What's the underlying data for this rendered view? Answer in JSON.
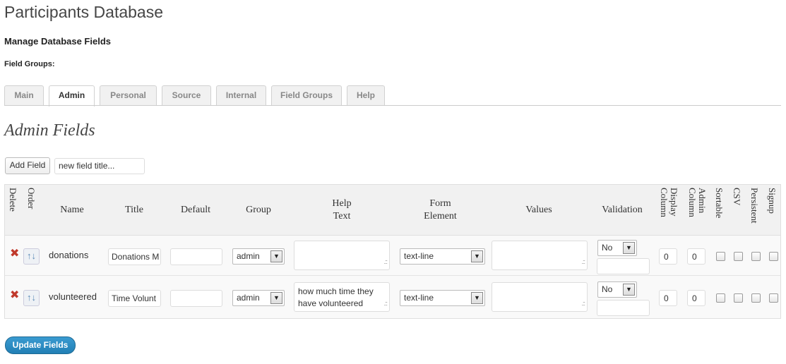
{
  "page": {
    "title": "Participants Database",
    "subtitle": "Manage Database Fields",
    "field_groups_label": "Field Groups:"
  },
  "tabs": [
    {
      "label": "Main"
    },
    {
      "label": "Admin",
      "active": true
    },
    {
      "label": "Personal"
    },
    {
      "label": "Source"
    },
    {
      "label": "Internal"
    },
    {
      "label": "Field Groups"
    },
    {
      "label": "Help"
    }
  ],
  "section": {
    "title": "Admin Fields"
  },
  "add_field": {
    "button_label": "Add Field",
    "input_value": "new field title..."
  },
  "table": {
    "headers": {
      "delete": "Delete",
      "order": "Order",
      "name": "Name",
      "title": "Title",
      "default": "Default",
      "group": "Group",
      "help_text_1": "Help",
      "help_text_2": "Text",
      "form_element_1": "Form",
      "form_element_2": "Element",
      "values": "Values",
      "validation": "Validation",
      "display_column": "Display Column",
      "admin_column": "Admin Column",
      "sortable": "Sortable",
      "csv": "CSV",
      "persistent": "Persistent",
      "signup": "Signup"
    },
    "rows": [
      {
        "name": "donations",
        "title": "Donations M",
        "default": "",
        "group": "admin",
        "help_text": "",
        "form_element": "text-line",
        "values": "",
        "validation": "No",
        "validation_extra": "",
        "display_column": "0",
        "admin_column": "0",
        "sortable": false,
        "csv": false,
        "persistent": false,
        "signup": false
      },
      {
        "name": "volunteered",
        "title": "Time Volunt",
        "default": "",
        "group": "admin",
        "help_text": "how much time they have volunteered",
        "form_element": "text-line",
        "values": "",
        "validation": "No",
        "validation_extra": "",
        "display_column": "0",
        "admin_column": "0",
        "sortable": false,
        "csv": false,
        "persistent": false,
        "signup": false
      }
    ]
  },
  "update_button": "Update Fields",
  "icons": {
    "delete": "x-icon",
    "order": "sort-arrows-icon",
    "dropdown": "chevron-down-icon"
  },
  "colors": {
    "delete_icon": "#c0392b",
    "update_button": "#2a8bc4"
  }
}
